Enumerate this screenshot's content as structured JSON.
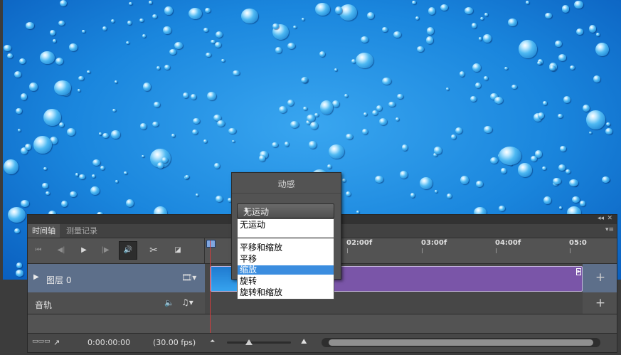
{
  "timeline": {
    "tabs": [
      "时间轴",
      "测量记录"
    ],
    "ruler_labels": [
      "02:00f",
      "03:00f",
      "04:00f",
      "05:0"
    ],
    "layer_name": "图层 0",
    "audio_track_name": "音轨",
    "timecode": "0:00:00:00",
    "fps": "(30.00 fps)"
  },
  "motion_popup": {
    "title": "动感",
    "selected": "无运动",
    "options": [
      "无运动",
      "平移和缩放",
      "平移",
      "缩放",
      "旋转",
      "旋转和缩放"
    ],
    "highlighted": "缩放"
  },
  "colors": {
    "panel": "#535353",
    "clip": "#7a55a8",
    "playhead": "#d23c3c",
    "highlight": "#3b8ddf"
  },
  "icons": [
    "go-to-first-frame-icon",
    "previous-frame-icon",
    "play-icon",
    "next-frame-icon",
    "audio-icon",
    "scissors-icon",
    "transition-icon",
    "filmstrip-icon",
    "music-note-icon",
    "convert-icon",
    "render-icon"
  ]
}
